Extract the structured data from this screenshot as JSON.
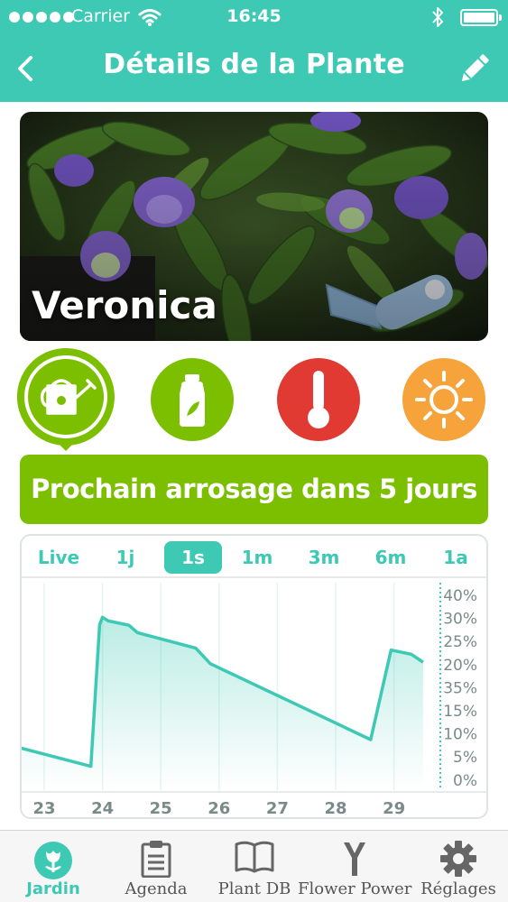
{
  "status_bar": {
    "carrier": "Carrier",
    "time": "16:45",
    "signal_icon": "signal-dots-icon",
    "wifi_icon": "wifi-icon",
    "bluetooth_icon": "bluetooth-icon",
    "battery_icon": "battery-icon"
  },
  "nav": {
    "title": "Détails de la Plante",
    "back_icon": "chevron-left-icon",
    "edit_icon": "pencil-icon"
  },
  "plant": {
    "name": "Veronica"
  },
  "status_icons": [
    {
      "name": "watering-can-icon",
      "color": "#7cbf00",
      "selected": true
    },
    {
      "name": "fertilizer-bottle-icon",
      "color": "#7cbf00",
      "selected": false
    },
    {
      "name": "thermometer-icon",
      "color": "#e03a33",
      "selected": false
    },
    {
      "name": "sun-icon",
      "color": "#f5a33a",
      "selected": false
    }
  ],
  "banner": {
    "text": "Prochain arrosage dans 5 jours"
  },
  "range_tabs": [
    {
      "label": "Live",
      "active": false
    },
    {
      "label": "1j",
      "active": false
    },
    {
      "label": "1s",
      "active": true
    },
    {
      "label": "1m",
      "active": false
    },
    {
      "label": "3m",
      "active": false
    },
    {
      "label": "6m",
      "active": false
    },
    {
      "label": "1a",
      "active": false
    }
  ],
  "chart_data": {
    "type": "area",
    "x_ticks": [
      "23",
      "24",
      "25",
      "26",
      "27",
      "28",
      "29"
    ],
    "y_ticks": [
      "40%",
      "30%",
      "25%",
      "20%",
      "35%",
      "15%",
      "10%",
      "5%",
      "0%"
    ],
    "ylim": [
      0,
      40
    ],
    "x": [
      22.2,
      23.8,
      23.95,
      24.0,
      24.1,
      24.45,
      24.6,
      25.6,
      25.85,
      28.6,
      28.95,
      29.3,
      29.5
    ],
    "values": [
      9.5,
      4.3,
      34.5,
      36.1,
      35.3,
      34.4,
      32.8,
      29.5,
      26.2,
      10.0,
      29.1,
      28.2,
      26.5
    ],
    "line_color": "#3dc9b4",
    "grid": true
  },
  "tab_bar": {
    "items": [
      {
        "label": "Jardin",
        "icon": "flower-icon",
        "active": true
      },
      {
        "label": "Agenda",
        "icon": "clipboard-icon",
        "active": false
      },
      {
        "label": "Plant DB",
        "icon": "book-icon",
        "active": false
      },
      {
        "label": "Flower Power",
        "icon": "sensor-y-icon",
        "active": false
      },
      {
        "label": "Réglages",
        "icon": "gear-icon",
        "active": false
      }
    ]
  }
}
